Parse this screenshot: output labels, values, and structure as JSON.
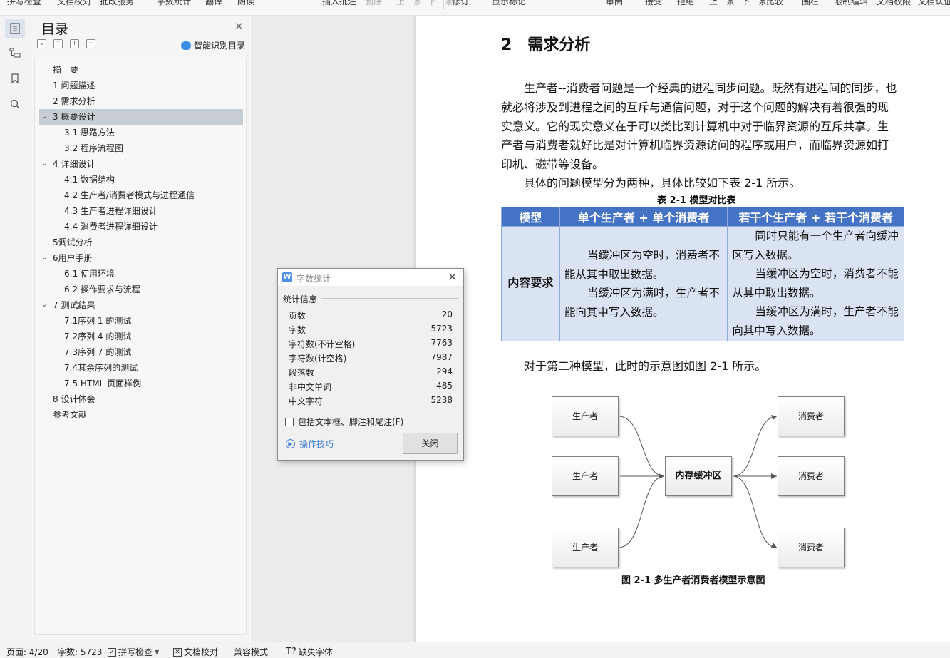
{
  "ribbon": {
    "items": [
      "拼写检查",
      "文档校对",
      "批改服务",
      "字数统计",
      "翻译",
      "朗读",
      "插入批注",
      "删除",
      "上一条",
      "下一条",
      "修订",
      "显示标记",
      "审阅",
      "接受",
      "拒绝",
      "上一条",
      "下一条",
      "比较",
      "围栏",
      "限制编辑",
      "文档权限",
      "文档认证"
    ]
  },
  "toc": {
    "title": "目录",
    "smart_label": "智能识别目录",
    "items": [
      {
        "label": "摘　要"
      },
      {
        "label": "1  问题描述"
      },
      {
        "label": "2  需求分析"
      },
      {
        "label": "3  概要设计"
      },
      {
        "label": "3.1  思路方法"
      },
      {
        "label": "3.2  程序流程图"
      },
      {
        "label": "4  详细设计"
      },
      {
        "label": "4.1  数据结构"
      },
      {
        "label": "4.2  生产者/消费者模式与进程通信"
      },
      {
        "label": "4.3  生产者进程详细设计"
      },
      {
        "label": "4.4  消费者进程详细设计"
      },
      {
        "label": "5调试分析"
      },
      {
        "label": "6用户手册"
      },
      {
        "label": "6.1  使用环境"
      },
      {
        "label": "6.2  操作要求与流程"
      },
      {
        "label": "7  测试结果"
      },
      {
        "label": "7.1序列 1 的测试"
      },
      {
        "label": "7.2序列 4 的测试"
      },
      {
        "label": "7.3序列 7 的测试"
      },
      {
        "label": "7.4其余序列的测试"
      },
      {
        "label": "7.5  HTML 页面样例"
      },
      {
        "label": "8  设计体会"
      },
      {
        "label": "参考文献"
      }
    ]
  },
  "doc": {
    "heading": "2　需求分析",
    "para1": "生产者--消费者问题是一个经典的进程同步问题。既然有进程间的同步，也就必将涉及到进程之间的互斥与通信问题，对于这个问题的解决有着很强的现实意义。它的现实意义在于可以类比到计算机中对于临界资源的互斥共享。生产者与消费者就好比是对计算机临界资源访问的程序或用户，而临界资源如打印机、磁带等设备。",
    "para2": "具体的问题模型分为两种，具体比较如下表 2-1 所示。",
    "table_caption": "表 2-1 模型对比表",
    "table": {
      "headers": [
        "模型",
        "单个生产者 + 单个消费者",
        "若干个生产者 + 若干个消费者"
      ],
      "row_label": "内容要求",
      "col1": [
        "当缓冲区为空时，消费者不能从其中取出数据。",
        "当缓冲区为满时，生产者不能向其中写入数据。"
      ],
      "col2": [
        "同时只能有一个生产者向缓冲区写入数据。",
        "当缓冲区为空时，消费者不能从其中取出数据。",
        "当缓冲区为满时，生产者不能向其中写入数据。"
      ]
    },
    "para3": "对于第二种模型，此时的示意图如图 2-1 所示。",
    "diagram": {
      "producer": "生产者",
      "consumer": "消费者",
      "buffer": "内存缓冲区",
      "caption": "图 2-1 多生产者消费者模型示意图"
    }
  },
  "dialog": {
    "title": "字数统计",
    "section": "统计信息",
    "stats": [
      {
        "label": "页数",
        "value": "20"
      },
      {
        "label": "字数",
        "value": "5723"
      },
      {
        "label": "字符数(不计空格)",
        "value": "7763"
      },
      {
        "label": "字符数(计空格)",
        "value": "7987"
      },
      {
        "label": "段落数",
        "value": "294"
      },
      {
        "label": "非中文单词",
        "value": "485"
      },
      {
        "label": "中文字符",
        "value": "5238"
      }
    ],
    "checkbox_label": "包括文本框、脚注和尾注(F)",
    "tips_label": "操作技巧",
    "close_label": "关闭"
  },
  "status": {
    "page": "页面: 4/20",
    "words": "字数: 5723",
    "spell": "拼写检查",
    "proof": "文档校对",
    "compat": "兼容模式",
    "missing_font": "缺失字体"
  }
}
